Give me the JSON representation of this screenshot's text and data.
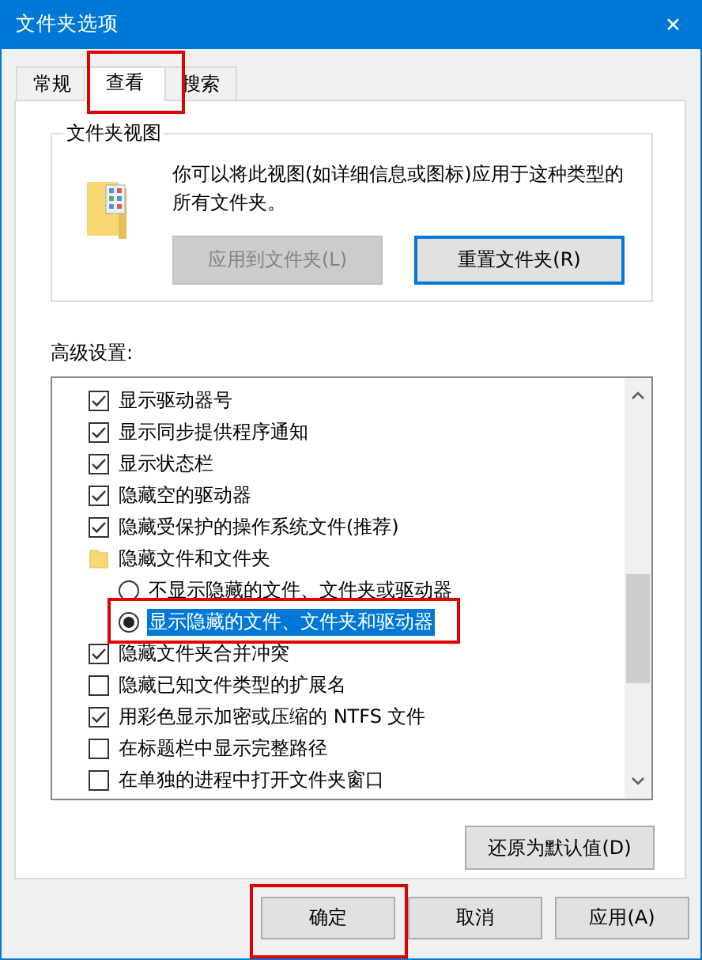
{
  "window": {
    "title": "文件夹选项",
    "close": "✕"
  },
  "tabs": [
    {
      "label": "常规",
      "selected": false,
      "annotated": false
    },
    {
      "label": "查看",
      "selected": true,
      "annotated": true
    },
    {
      "label": "搜索",
      "selected": false,
      "annotated": false
    }
  ],
  "folder_views": {
    "title": "文件夹视图",
    "description": "你可以将此视图(如详细信息或图标)应用于这种类型的所有文件夹。",
    "buttons": [
      {
        "label": "应用到文件夹(L)",
        "disabled": true,
        "focused": false
      },
      {
        "label": "重置文件夹(R)",
        "disabled": false,
        "focused": true
      }
    ]
  },
  "advanced": {
    "label": "高级设置:",
    "items": [
      {
        "kind": "checkbox",
        "label": "显示驱动器号",
        "checked": true
      },
      {
        "kind": "checkbox",
        "label": "显示同步提供程序通知",
        "checked": true
      },
      {
        "kind": "checkbox",
        "label": "显示状态栏",
        "checked": true
      },
      {
        "kind": "checkbox",
        "label": "隐藏空的驱动器",
        "checked": true
      },
      {
        "kind": "checkbox",
        "label": "隐藏受保护的操作系统文件(推荐)",
        "checked": true
      },
      {
        "kind": "folder",
        "label": "隐藏文件和文件夹",
        "children": [
          {
            "kind": "radio",
            "label": "不显示隐藏的文件、文件夹或驱动器",
            "checked": false,
            "selected": false,
            "annotated": false
          },
          {
            "kind": "radio",
            "label": "显示隐藏的文件、文件夹和驱动器",
            "checked": true,
            "selected": true,
            "annotated": true
          }
        ]
      },
      {
        "kind": "checkbox",
        "label": "隐藏文件夹合并冲突",
        "checked": true
      },
      {
        "kind": "checkbox",
        "label": "隐藏已知文件类型的扩展名",
        "checked": false
      },
      {
        "kind": "checkbox",
        "label": "用彩色显示加密或压缩的 NTFS 文件",
        "checked": true
      },
      {
        "kind": "checkbox",
        "label": "在标题栏中显示完整路径",
        "checked": false
      },
      {
        "kind": "checkbox",
        "label": "在单独的进程中打开文件夹窗口",
        "checked": false
      }
    ],
    "restore_button": "还原为默认值(D)"
  },
  "buttons": [
    {
      "label": "确定",
      "annotated": true
    },
    {
      "label": "取消",
      "annotated": false
    },
    {
      "label": "应用(A)",
      "annotated": false
    }
  ]
}
